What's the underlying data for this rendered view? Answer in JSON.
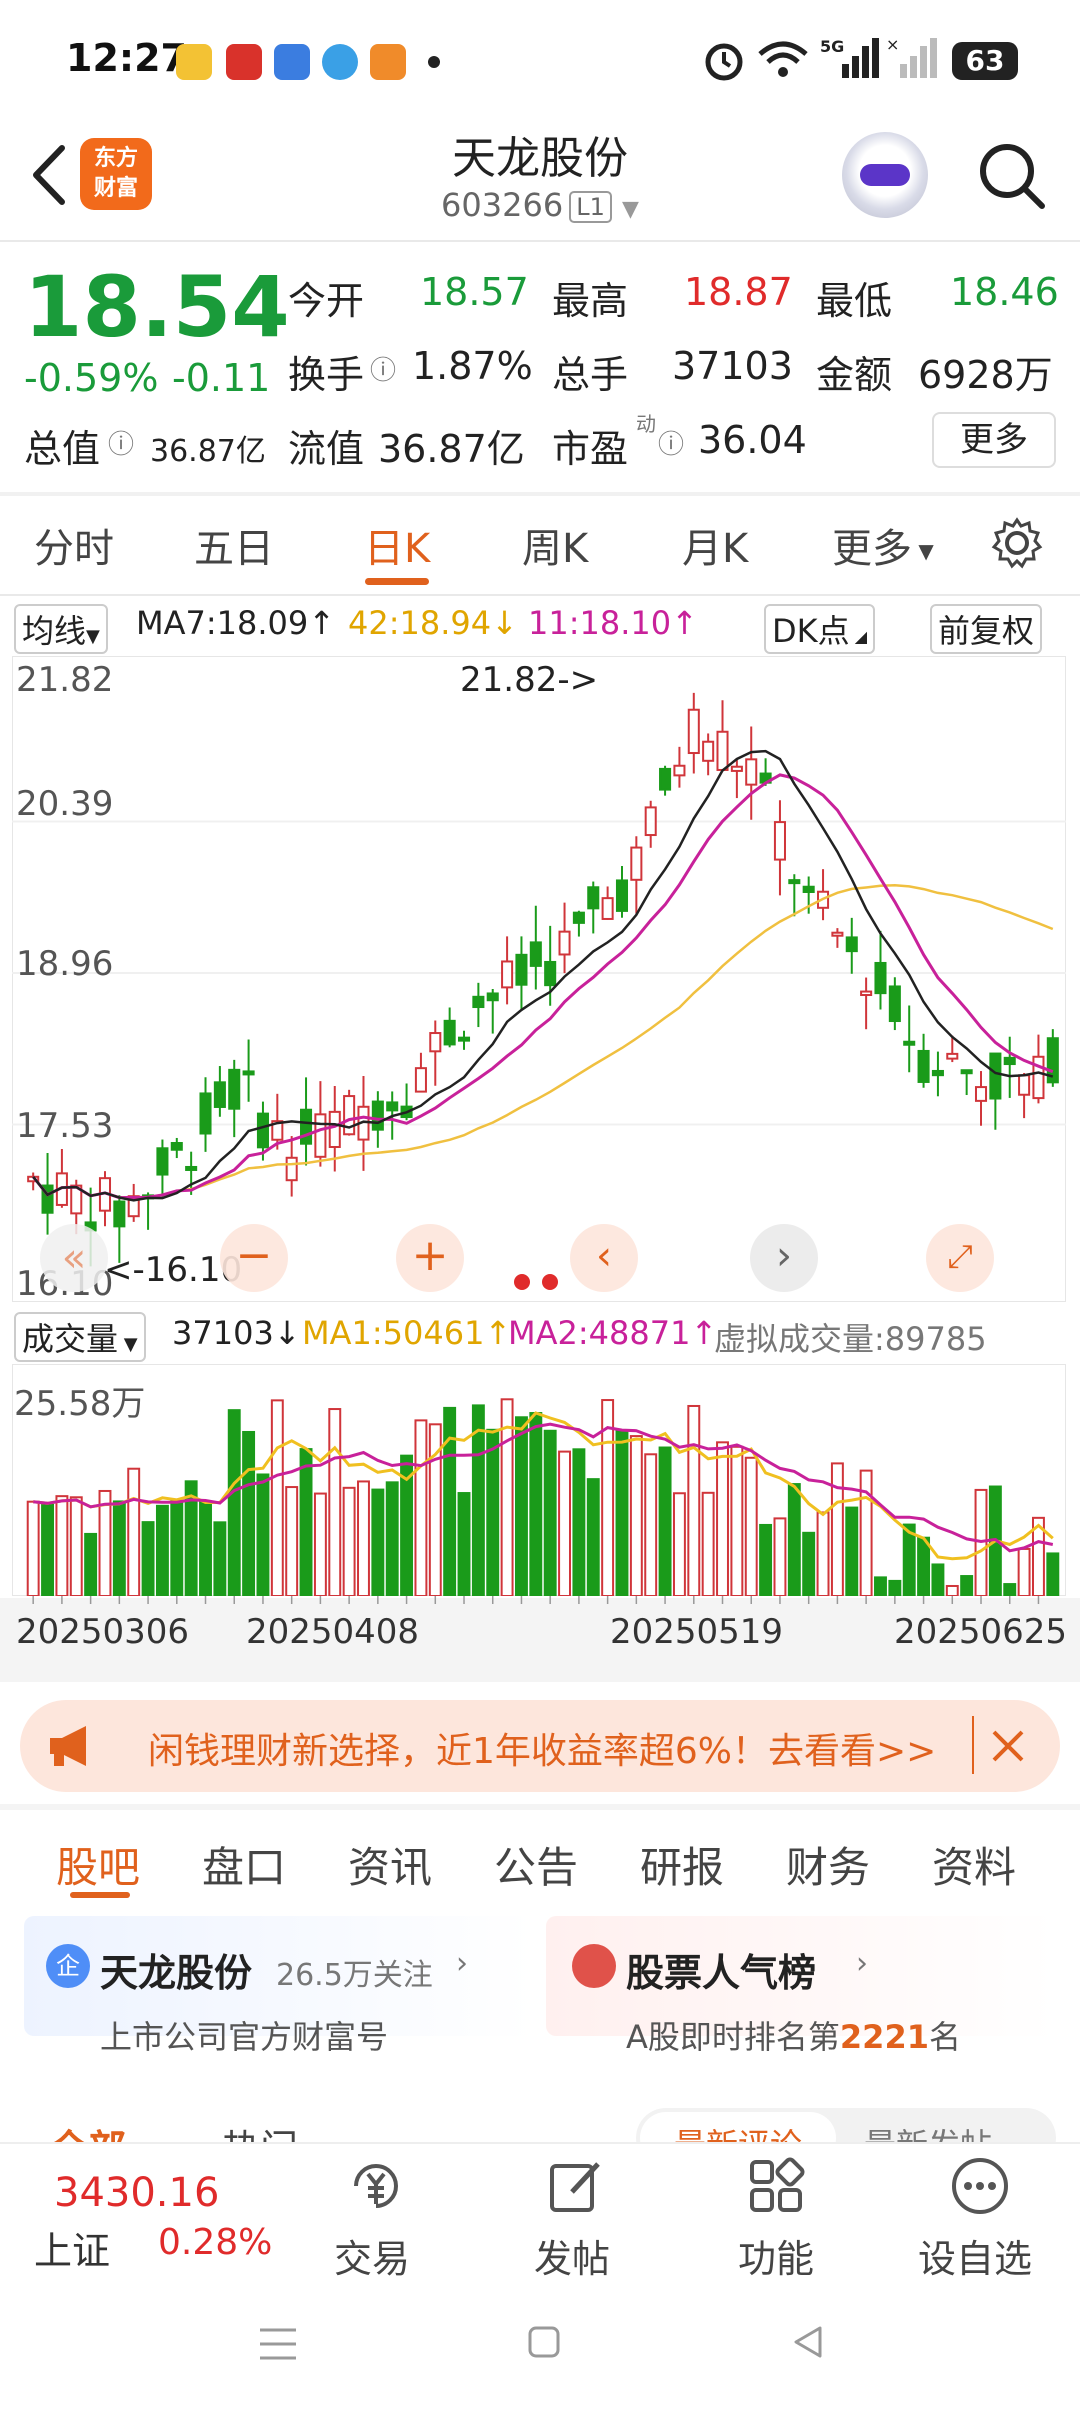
{
  "status_bar": {
    "time": "12:27",
    "signal_label": "5G",
    "battery": "63"
  },
  "header": {
    "title": "天龙股份",
    "code": "603266",
    "level": "L1",
    "logo_line1": "东方",
    "logo_line2": "财富"
  },
  "quote": {
    "price": "18.54",
    "change_pct": "-0.59%",
    "change": "-0.11",
    "open_label": "今开",
    "open": "18.57",
    "high_label": "最高",
    "high": "18.87",
    "low_label": "最低",
    "low": "18.46",
    "turnover_label": "换手",
    "turnover": "1.87%",
    "volume_label": "总手",
    "volume": "37103",
    "amount_label": "金额",
    "amount": "6928万",
    "mktcap_label": "总值",
    "mktcap": "36.87亿",
    "float_label": "流值",
    "float": "36.87亿",
    "pe_label": "市盈",
    "pe_sup": "动",
    "pe": "36.04",
    "more": "更多"
  },
  "tabs": [
    "分时",
    "五日",
    "日K",
    "周K",
    "月K",
    "更多"
  ],
  "ma_bar": {
    "select": "均线",
    "ma7": "MA7:18.09↑",
    "ma42": "42:18.94↓",
    "ma11": "11:18.10↑",
    "dk": "DK点",
    "adjust": "前复权"
  },
  "price_axis": [
    "21.82",
    "20.39",
    "18.96",
    "17.53",
    "16.10"
  ],
  "high_marker": "21.82->",
  "low_marker": "<-16.10",
  "volume_bar": {
    "select": "成交量",
    "vol": "37103↓",
    "ma1": "MA1:50461↑",
    "ma2": "MA2:48871↑",
    "virtual": "虚拟成交量:89785"
  },
  "volume_axis": "25.58万",
  "dates": [
    "20250306",
    "20250408",
    "20250519",
    "20250625"
  ],
  "banner": {
    "text": "闲钱理财新选择，近1年收益率超6%！去看看>>"
  },
  "section_tabs": [
    "股吧",
    "盘口",
    "资讯",
    "公告",
    "研报",
    "财务",
    "资料"
  ],
  "card1": {
    "icon": "企",
    "title": "天龙股份",
    "follow": "26.5万关注",
    "subtitle": "上市公司官方财富号"
  },
  "card2": {
    "title": "股票人气榜",
    "subtitle_pre": "A股即时排名第",
    "rank": "2221",
    "subtitle_post": "名"
  },
  "sub_tabs": {
    "all": "全部",
    "hot": "热门",
    "latest_reply": "最新评论",
    "latest_post": "最新发帖"
  },
  "index": {
    "value": "3430.16",
    "name": "上证",
    "change": "0.28%"
  },
  "bottom_actions": [
    "交易",
    "发帖",
    "功能",
    "设自选"
  ],
  "colors": {
    "up": "#e02b2b",
    "down": "#1a9b3a",
    "accent": "#e0611d",
    "ma_gold": "#e0a500",
    "ma_mag": "#c8219a"
  },
  "chart_data": {
    "type": "candlestick",
    "price_range": [
      16.1,
      21.82
    ],
    "volume_max_label": "25.58万",
    "date_ticks": [
      "20250306",
      "20250408",
      "20250519",
      "20250625"
    ],
    "last_close": 18.54
  }
}
